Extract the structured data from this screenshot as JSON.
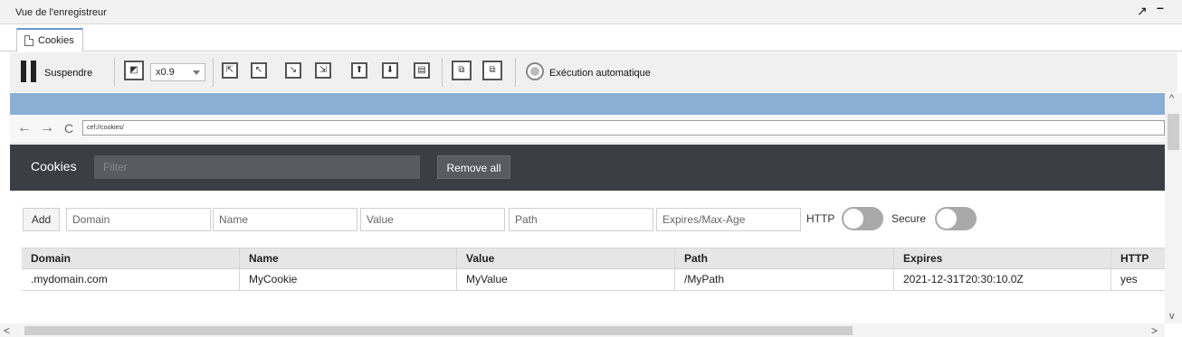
{
  "window": {
    "title": "Vue de l'enregistreur",
    "restore_icon": "undock-arrow-icon",
    "minimize_icon": "minimize-icon"
  },
  "tabs": [
    {
      "label": "Cookies",
      "icon": "document-icon"
    }
  ],
  "toolbar": {
    "pause_label": "Suspendre",
    "zoom_value": "x0.9",
    "auto_label": "Exécution automatique"
  },
  "browser": {
    "back": "←",
    "forward": "→",
    "reload": "C",
    "address": "cef://cookies/"
  },
  "cookies_panel": {
    "title": "Cookies",
    "filter_placeholder": "Filter",
    "remove_all_label": "Remove all"
  },
  "add_form": {
    "add_label": "Add",
    "domain_placeholder": "Domain",
    "name_placeholder": "Name",
    "value_placeholder": "Value",
    "path_placeholder": "Path",
    "expires_placeholder": "Expires/Max-Age",
    "http_label": "HTTP",
    "secure_label": "Secure"
  },
  "table": {
    "columns": [
      "Domain",
      "Name",
      "Value",
      "Path",
      "Expires",
      "HTTP"
    ],
    "rows": [
      [
        ".mydomain.com",
        "MyCookie",
        "MyValue",
        "/MyPath",
        "2021-12-31T20:30:10.0Z",
        "yes"
      ]
    ]
  },
  "colors": {
    "accent_blue": "#8aaed4",
    "dark_header": "#3b3e45"
  }
}
